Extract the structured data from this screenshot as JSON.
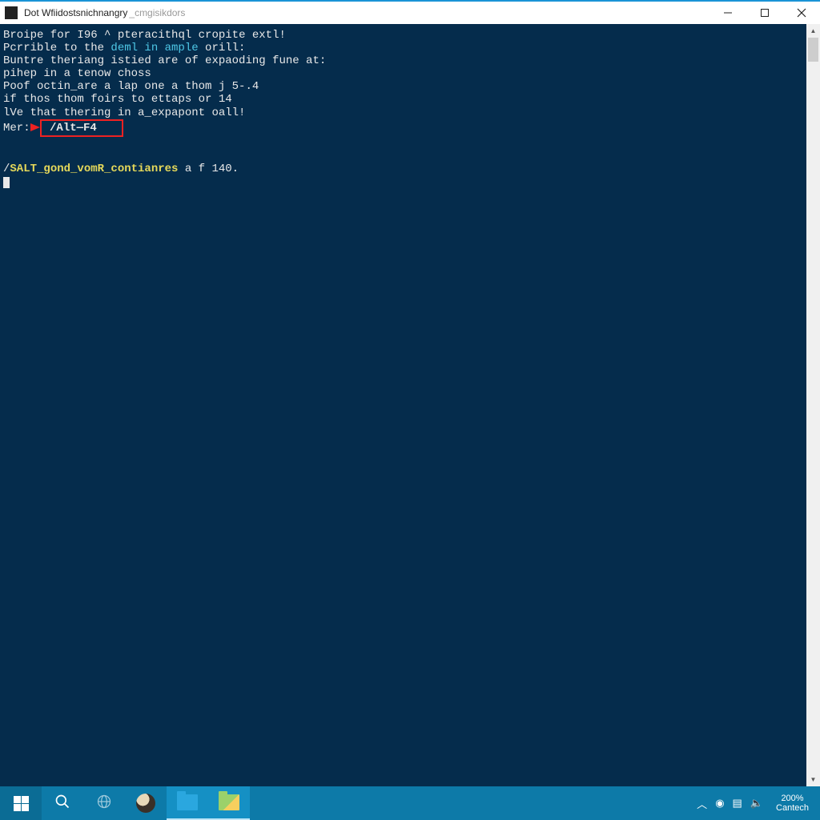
{
  "window": {
    "title_primary": "Dot Wfiidostsnichnangry",
    "title_secondary": "_cmgisikdors"
  },
  "terminal": {
    "lines": [
      {
        "segments": [
          {
            "t": "Broipe for I96 ",
            "c": "w"
          },
          {
            "t": "^",
            "c": "w"
          },
          {
            "t": " pteracithql cropite extl!",
            "c": "w"
          }
        ]
      },
      {
        "segments": [
          {
            "t": "Pcrrible to the ",
            "c": "w"
          },
          {
            "t": "deml in ample",
            "c": "c"
          },
          {
            "t": " orill:",
            "c": "w"
          }
        ]
      },
      {
        "segments": [
          {
            "t": "",
            "c": "w"
          }
        ]
      },
      {
        "segments": [
          {
            "t": "Buntre theriang istied are of expaoding fune at:",
            "c": "w"
          }
        ]
      },
      {
        "segments": [
          {
            "t": "pihep in a tenow choss",
            "c": "w"
          }
        ]
      },
      {
        "segments": [
          {
            "t": "",
            "c": "w"
          }
        ]
      },
      {
        "segments": [
          {
            "t": "Poof octin_are a lap one a thom j 5-.4",
            "c": "w"
          }
        ]
      },
      {
        "segments": [
          {
            "t": "if thos thom foirs to ettaps or 14",
            "c": "w"
          }
        ]
      },
      {
        "segments": [
          {
            "t": "lVe that thering in a_expapont oall!",
            "c": "w"
          }
        ]
      },
      {
        "segments": [
          {
            "t": "",
            "c": "w"
          }
        ]
      }
    ],
    "highlight_prefix": "Mer:",
    "highlight_content": "/Alt—F4",
    "prompt_line_pre": "/",
    "prompt_line_highlight": "SALT_gond_vomR_contianres",
    "prompt_line_post": " a f 140."
  },
  "taskbar": {
    "zoom": "200%",
    "brand": "Cantech"
  },
  "icons": {
    "start": "windows-start-icon",
    "search": "search-icon",
    "globe": "globe-icon",
    "app_round": "app-round-icon",
    "folder_explorer": "file-explorer-icon",
    "folder_active": "folder-app-icon",
    "tray_up": "tray-overflow-icon",
    "tray_disk": "disk-icon",
    "tray_net": "network-icon",
    "tray_vol": "volume-icon"
  }
}
